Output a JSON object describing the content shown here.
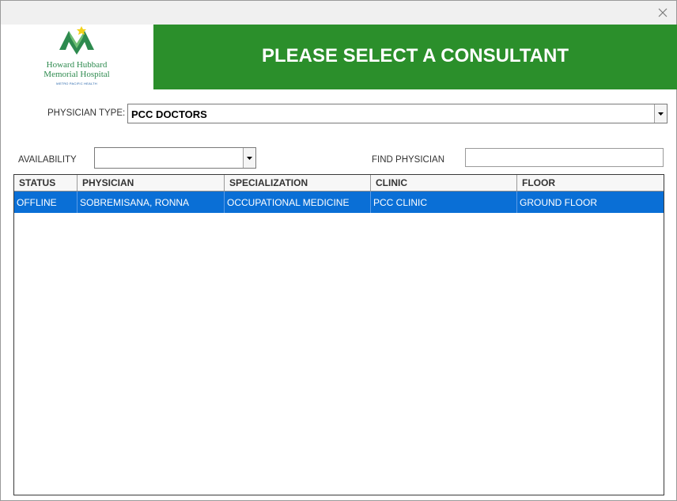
{
  "window": {
    "close_icon": "close-icon"
  },
  "logo": {
    "line1": "Howard Hubbard",
    "line2": "Memorial Hospital",
    "sub": "METRO PACIFIC HEALTH",
    "colors": {
      "green": "#2d8a4e",
      "yellow": "#f2d21b",
      "blue": "#1f5fa6"
    }
  },
  "banner": {
    "title": "PLEASE SELECT A CONSULTANT",
    "color": "#2b8f2b"
  },
  "filters": {
    "physician_type_label": "PHYSICIAN TYPE:",
    "physician_type_value": "PCC DOCTORS",
    "availability_label": "AVAILABILITY",
    "availability_value": "",
    "find_label": "FIND PHYSICIAN",
    "find_value": ""
  },
  "table": {
    "columns": [
      "STATUS",
      "PHYSICIAN",
      "SPECIALIZATION",
      "CLINIC",
      "FLOOR"
    ],
    "rows": [
      {
        "status": "OFFLINE",
        "physician": "SOBREMISANA, RONNA",
        "specialization": "OCCUPATIONAL MEDICINE",
        "clinic": "PCC CLINIC",
        "floor": "GROUND FLOOR",
        "selected": true
      }
    ],
    "selection_color": "#0a6fd6"
  }
}
